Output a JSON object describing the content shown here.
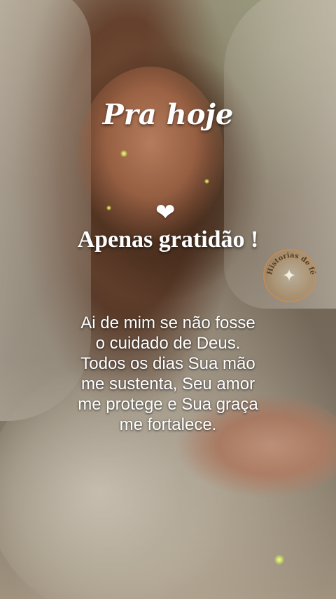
{
  "post": {
    "title": "Pra hoje",
    "heart_icon": "white-heart-icon",
    "subtitle": "Apenas gratidão !",
    "message_lines": [
      "Ai de mim se não fosse",
      "o cuidado de Deus.",
      "Todos os dias Sua mão",
      "me sustenta, Seu amor",
      "me protege e Sua graça",
      "me fortalece."
    ]
  },
  "watermark": {
    "text": "Historias de fé",
    "icon": "dove-icon"
  },
  "colors": {
    "text": "#ffffff",
    "glow": "#e8ff70",
    "logo_ring": "#dc8c3c"
  }
}
